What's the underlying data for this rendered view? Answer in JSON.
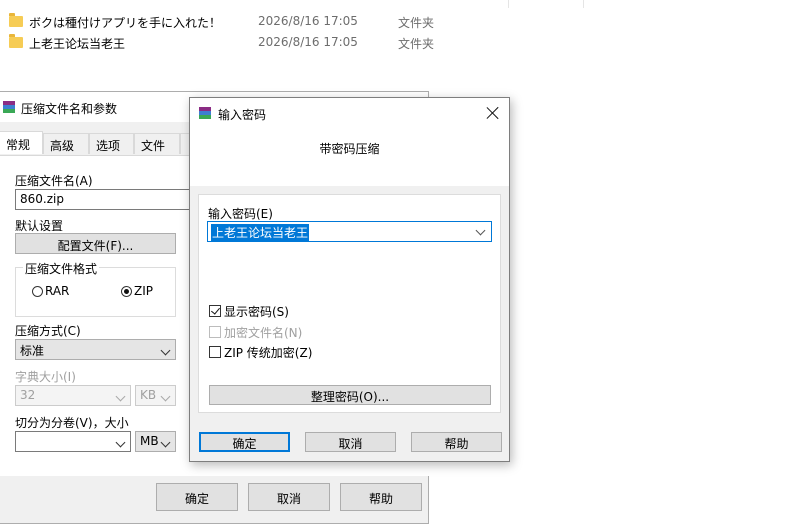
{
  "explorer": {
    "files": [
      {
        "name": "ボクは種付けアプリを手に入れた！",
        "date": "2026/8/16 17:05",
        "type": "文件夹",
        "icon": "folder-icon"
      },
      {
        "name": "上老王论坛当老王",
        "date": "2026/8/16 17:05",
        "type": "文件夹",
        "icon": "folder-icon"
      }
    ]
  },
  "archive_dialog": {
    "title": "压缩文件名和参数",
    "tabs": [
      "常规",
      "高级",
      "选项",
      "文件",
      ""
    ],
    "archive_name_label": "压缩文件名(A)",
    "archive_name_value": "860.zip",
    "default_settings_label": "默认设置",
    "profiles_button": "配置文件(F)...",
    "format_group_label": "压缩文件格式",
    "format_options": [
      "RAR",
      "ZIP"
    ],
    "format_selected": "ZIP",
    "method_label": "压缩方式(C)",
    "method_value": "标准",
    "dict_label": "字典大小(I)",
    "dict_value": "32",
    "dict_unit": "KB",
    "split_label": "切分为分卷(V)，大小",
    "split_value": "",
    "split_unit": "MB",
    "ok_button": "确定",
    "cancel_button": "取消",
    "help_button": "帮助"
  },
  "password_dialog": {
    "title": "输入密码",
    "heading": "带密码压缩",
    "password_label": "输入密码(E)",
    "password_value": "上老王论坛当老王",
    "show_password": {
      "label": "显示密码(S)",
      "checked": true
    },
    "encrypt_names": {
      "label": "加密文件名(N)",
      "checked": false,
      "enabled": false
    },
    "zip_legacy": {
      "label": "ZIP 传统加密(Z)",
      "checked": false
    },
    "organize_button": "整理密码(O)...",
    "ok_button": "确定",
    "cancel_button": "取消",
    "help_button": "帮助"
  },
  "colors": {
    "accent": "#0078d7",
    "folder": "#f6cc55",
    "dialog_bg": "#f0f0f0"
  }
}
